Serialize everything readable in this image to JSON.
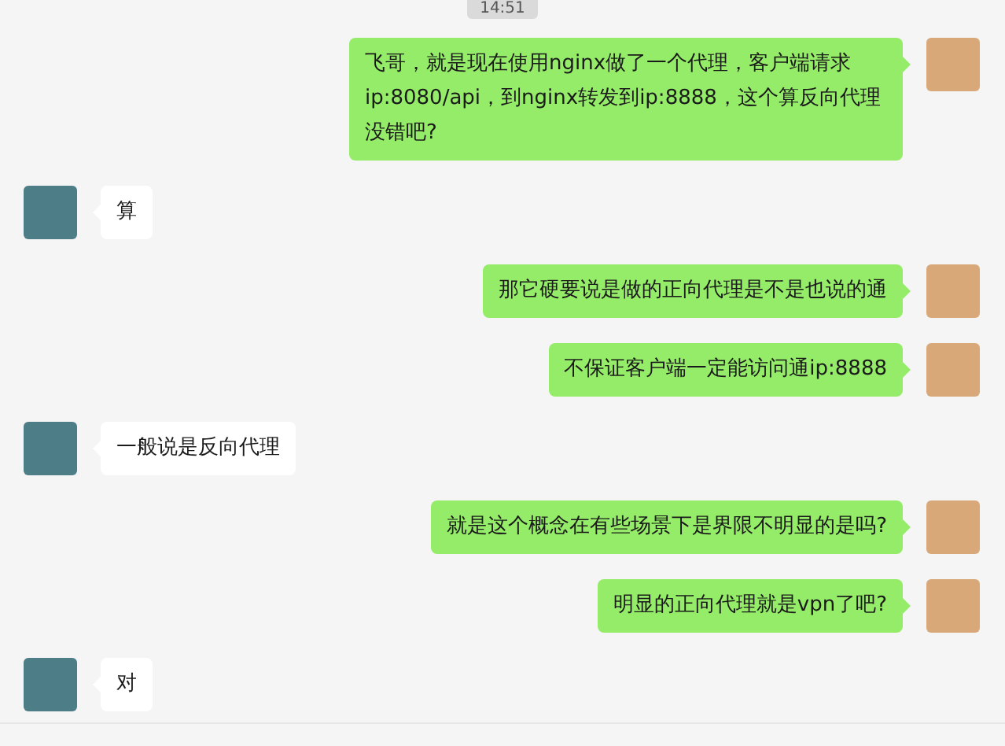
{
  "timestamp": "14:51",
  "messages": [
    {
      "kind": "sent",
      "text": "飞哥，就是现在使用nginx做了一个代理，客户端请求ip:8080/api，到nginx转发到ip:8888，这个算反向代理没错吧?"
    },
    {
      "kind": "received",
      "text": "算"
    },
    {
      "kind": "sent",
      "text": "那它硬要说是做的正向代理是不是也说的通"
    },
    {
      "kind": "sent",
      "text": "不保证客户端一定能访问通ip:8888"
    },
    {
      "kind": "received",
      "text": "一般说是反向代理"
    },
    {
      "kind": "sent",
      "text": "就是这个概念在有些场景下是界限不明显的是吗?"
    },
    {
      "kind": "sent",
      "text": "明显的正向代理就是vpn了吧?"
    },
    {
      "kind": "received",
      "text": "对"
    }
  ]
}
